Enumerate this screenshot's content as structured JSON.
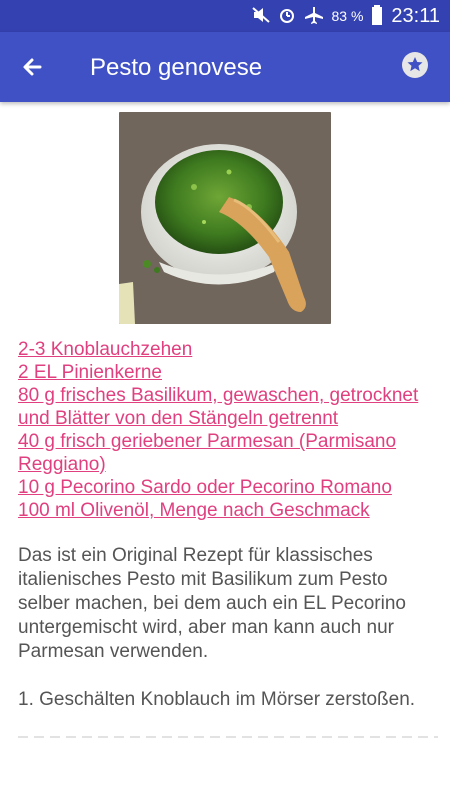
{
  "status": {
    "battery": "83 %",
    "time": "23:11"
  },
  "appbar": {
    "title": "Pesto genovese"
  },
  "ingredients": [
    "2-3 Knoblauchzehen",
    "2 EL Pinienkerne",
    "80 g frisches Basilikum, gewaschen, getrocknet und Blätter von den Stängeln getrennt",
    "40 g frisch geriebener Parmesan (Parmisano Reggiano)",
    "10 g Pecorino Sardo oder Pecorino Romano",
    "100 ml Olivenöl, Menge nach Geschmack"
  ],
  "description": "Das ist ein Original Rezept für klassisches italienisches Pesto mit Basilikum zum Pesto selber machen, bei dem auch ein EL Pecorino untergemischt wird, aber man kann auch nur Parmesan verwenden.",
  "steps": [
    "1. Geschälten Knoblauch im Mörser zerstoßen."
  ],
  "colors": {
    "statusbar": "#3441b0",
    "appbar": "#3f51c5",
    "link": "#e0407f",
    "text": "#555555"
  }
}
